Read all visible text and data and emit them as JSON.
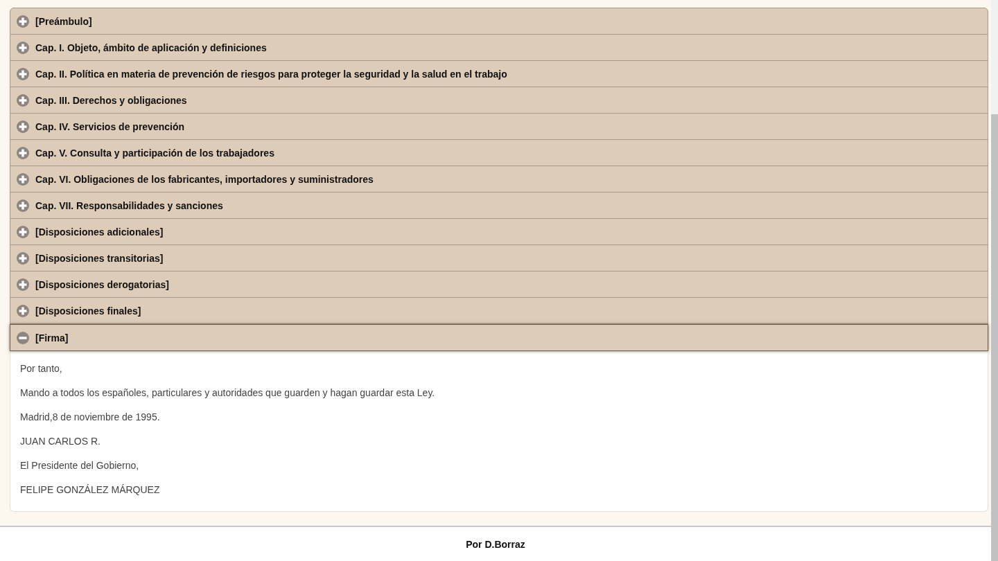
{
  "accordion": [
    {
      "title": "[Preámbulo]",
      "expanded": false
    },
    {
      "title": "Cap. I. Objeto, ámbito de aplicación y definiciones",
      "expanded": false
    },
    {
      "title": "Cap. II. Política en materia de prevención de riesgos para proteger la seguridad y la salud en el trabajo",
      "expanded": false
    },
    {
      "title": "Cap. III. Derechos y obligaciones",
      "expanded": false
    },
    {
      "title": "Cap. IV. Servicios de prevención",
      "expanded": false
    },
    {
      "title": "Cap. V. Consulta y participación de los trabajadores",
      "expanded": false
    },
    {
      "title": "Cap. VI. Obligaciones de los fabricantes, importadores y suministradores",
      "expanded": false
    },
    {
      "title": "Cap. VII. Responsabilidades y sanciones",
      "expanded": false
    },
    {
      "title": "[Disposiciones adicionales]",
      "expanded": false
    },
    {
      "title": "[Disposiciones transitorias]",
      "expanded": false
    },
    {
      "title": "[Disposiciones derogatorias]",
      "expanded": false
    },
    {
      "title": "[Disposiciones finales]",
      "expanded": false
    },
    {
      "title": "[Firma]",
      "expanded": true,
      "paragraphs": [
        "Por tanto,",
        "Mando a todos los españoles, particulares y autoridades que guarden y hagan guardar esta Ley.",
        "Madrid,8 de noviembre de 1995.",
        "JUAN CARLOS R.",
        "El Presidente del Gobierno,",
        "FELIPE GONZÁLEZ MÁRQUEZ"
      ]
    }
  ],
  "footer": {
    "text": "Por D.Borraz"
  }
}
